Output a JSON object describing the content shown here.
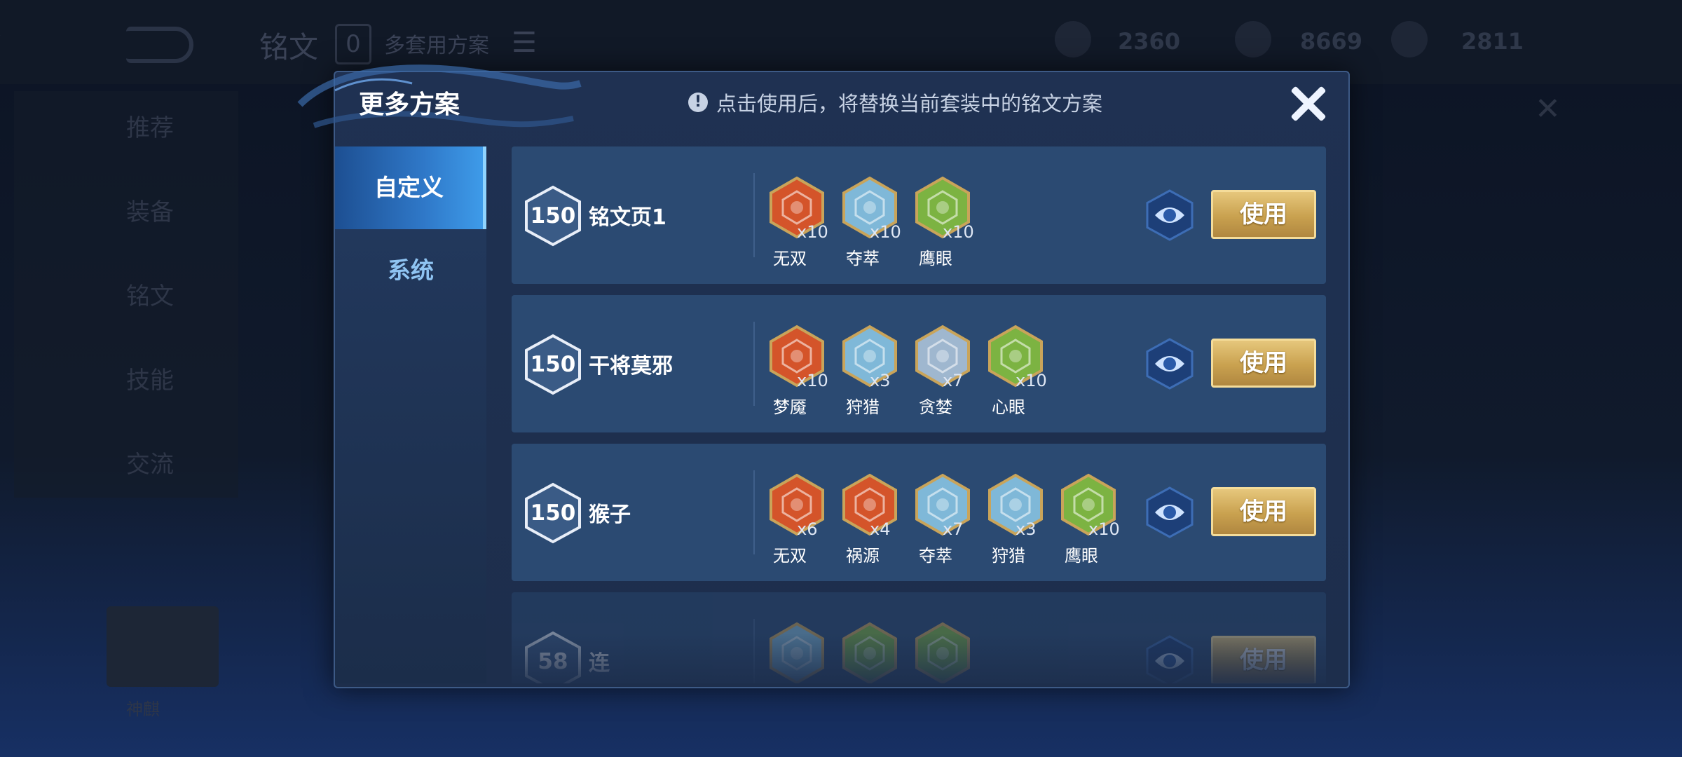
{
  "background": {
    "title": "铭文",
    "count": "0",
    "scheme_label": "多套用方案",
    "stat_1": "2360",
    "stat_2": "8669",
    "stat_3": "2811",
    "left_items": [
      "推荐",
      "装备",
      "铭文",
      "技能",
      "交流"
    ],
    "hero_name": "神麒"
  },
  "modal": {
    "title": "更多方案",
    "notice": "点击使用后，将替换当前套装中的铭文方案",
    "tabs": [
      {
        "label": "自定义",
        "active": true
      },
      {
        "label": "系统",
        "active": false
      }
    ],
    "use_label": "使用",
    "plans": [
      {
        "level": "150",
        "name": "铭文页1",
        "runes": [
          {
            "name": "无双",
            "count": "x10",
            "color": "#d4542a"
          },
          {
            "name": "夺萃",
            "count": "x10",
            "color": "#7fb8d8"
          },
          {
            "name": "鹰眼",
            "count": "x10",
            "color": "#7cb342"
          }
        ]
      },
      {
        "level": "150",
        "name": "干将莫邪",
        "runes": [
          {
            "name": "梦魇",
            "count": "x10",
            "color": "#d4542a"
          },
          {
            "name": "狩猎",
            "count": "x3",
            "color": "#7fb8d8"
          },
          {
            "name": "贪婪",
            "count": "x7",
            "color": "#9fb7cf"
          },
          {
            "name": "心眼",
            "count": "x10",
            "color": "#7cb342"
          }
        ]
      },
      {
        "level": "150",
        "name": "猴子",
        "runes": [
          {
            "name": "无双",
            "count": "x6",
            "color": "#d4542a"
          },
          {
            "name": "祸源",
            "count": "x4",
            "color": "#d4542a"
          },
          {
            "name": "夺萃",
            "count": "x7",
            "color": "#7fb8d8"
          },
          {
            "name": "狩猎",
            "count": "x3",
            "color": "#7fb8d8"
          },
          {
            "name": "鹰眼",
            "count": "x10",
            "color": "#7cb342"
          }
        ]
      },
      {
        "level": "58",
        "name": "连",
        "runes": [
          {
            "name": "",
            "count": "",
            "color": "#7fb8d8"
          },
          {
            "name": "",
            "count": "",
            "color": "#7cb342"
          },
          {
            "name": "",
            "count": "",
            "color": "#7cb342"
          }
        ]
      }
    ]
  }
}
